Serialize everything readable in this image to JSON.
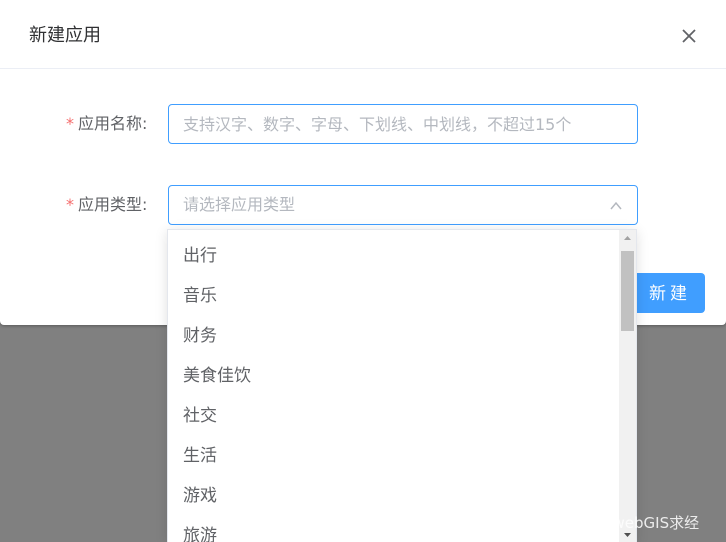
{
  "dialog": {
    "title": "新建应用",
    "close_icon": "close-icon"
  },
  "form": {
    "name": {
      "required_mark": "*",
      "label": "应用名称:",
      "value": "",
      "placeholder": "支持汉字、数字、字母、下划线、中划线，不超过15个"
    },
    "type": {
      "required_mark": "*",
      "label": "应用类型:",
      "placeholder": "请选择应用类型",
      "arrow_icon": "chevron-up-icon",
      "open": true
    }
  },
  "footer": {
    "create_label": "新建"
  },
  "dropdown": {
    "options": [
      "出行",
      "音乐",
      "财务",
      "美食佳饮",
      "社交",
      "生活",
      "游戏",
      "旅游"
    ]
  },
  "watermark": "CSDN @webGIS求经",
  "colors": {
    "primary": "#409eff",
    "required": "#f56c6c",
    "overlay": "#808080",
    "placeholder": "#b4b8bf"
  }
}
